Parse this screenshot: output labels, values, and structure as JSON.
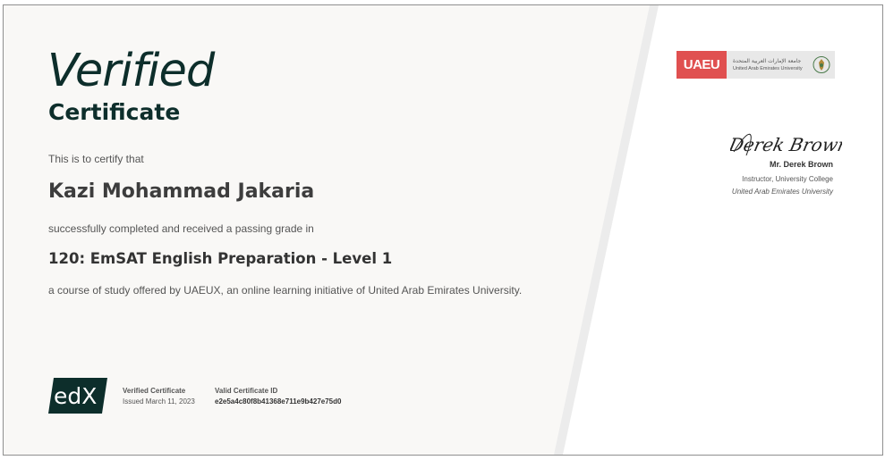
{
  "certificate": {
    "title": "Verified",
    "subtitle": "Certificate",
    "certify_text": "This is to certify that",
    "recipient_name": "Kazi Mohammad Jakaria",
    "completion_text": "successfully completed and received a passing grade in",
    "course_title": "120: EmSAT English Preparation - Level 1",
    "course_desc": "a course of study offered by UAEUX, an online learning initiative of United Arab Emirates University."
  },
  "footer": {
    "logo_text": "edX",
    "verified_label": "Verified Certificate",
    "issued_date": "Issued March 11, 2023",
    "id_label": "Valid Certificate ID",
    "id_value": "e2e5a4c80f8b41368e711e9b427e75d0"
  },
  "institution": {
    "logo_abbr": "UAEU",
    "arabic_name": "جامعة الإمارات العربية المتحدة",
    "english_name": "United Arab Emirates University"
  },
  "signatory": {
    "signature_text": "Derek Brown",
    "name": "Mr. Derek Brown",
    "role": "Instructor, University College",
    "organization": "United Arab Emirates University"
  },
  "colors": {
    "primary": "#0d2e2b",
    "left_panel": "#f9f8f6",
    "divider": "#ececec",
    "logo_red": "#e05050"
  }
}
